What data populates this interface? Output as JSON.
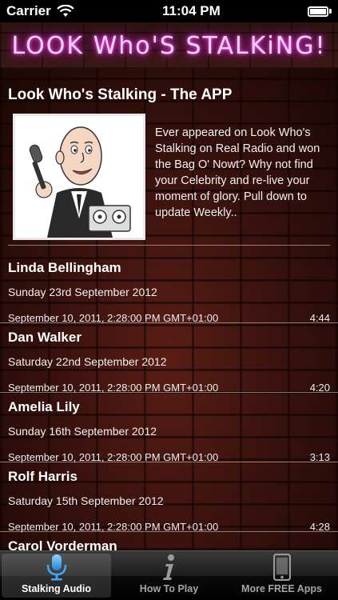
{
  "status_bar": {
    "carrier": "Carrier",
    "time": "11:04 PM"
  },
  "header": {
    "title": "LOOK Who'S STALKiNG!"
  },
  "app_info": {
    "heading": "Look Who's Stalking - The APP",
    "description": "Ever appeared on Look Who's Stalking on Real Radio and won the Bag O' Nowt? Why not find your Celebrity and re-live your moment of glory. Pull down to update Weekly.."
  },
  "episodes": [
    {
      "name": "Linda Bellingham",
      "date": "Sunday 23rd September 2012",
      "published": "September 10, 2011, 2:28:00 PM GMT+01:00",
      "duration": "4:44"
    },
    {
      "name": "Dan Walker",
      "date": "Saturday 22nd September 2012",
      "published": "September 10, 2011, 2:28:00 PM GMT+01:00",
      "duration": "4:20"
    },
    {
      "name": "Amelia Lily",
      "date": "Sunday 16th September 2012",
      "published": "September 10, 2011, 2:28:00 PM GMT+01:00",
      "duration": "3:13"
    },
    {
      "name": "Rolf Harris",
      "date": "Saturday 15th September 2012",
      "published": "September 10, 2011, 2:28:00 PM GMT+01:00",
      "duration": "4:28"
    },
    {
      "name": "Carol Vorderman"
    }
  ],
  "tabs": [
    {
      "label": "Stalking Audio",
      "icon": "microphone-icon",
      "active": true
    },
    {
      "label": "How To Play",
      "icon": "info-icon",
      "active": false
    },
    {
      "label": "More FREE Apps",
      "icon": "phone-icon",
      "active": false
    }
  ],
  "colors": {
    "neon": "#ff5cf0",
    "accent_blue": "#3fa9f5"
  }
}
